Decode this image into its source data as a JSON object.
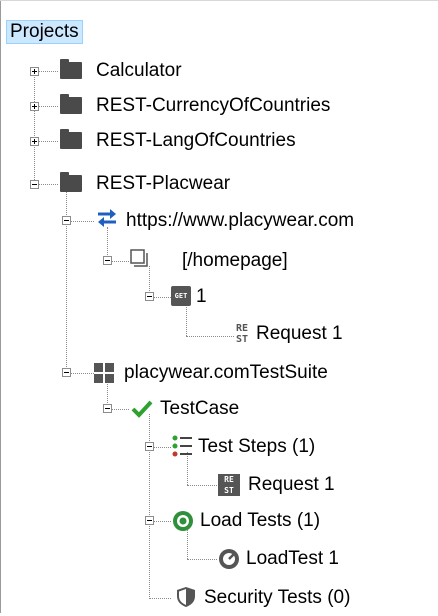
{
  "tree": {
    "root_label": "Projects",
    "projects": [
      {
        "label": "Calculator"
      },
      {
        "label": "REST-CurrencyOfCountries"
      },
      {
        "label": "REST-LangOfCountries"
      },
      {
        "label": "REST-Placwear"
      }
    ],
    "service": {
      "label": "https://www.placywear.com"
    },
    "resource": {
      "label": "[/homepage]"
    },
    "method": {
      "label": "1",
      "badge": "GET"
    },
    "request": {
      "label": "Request 1",
      "badge_top": "RE",
      "badge_bottom": "ST"
    },
    "suite": {
      "label": "placywear.comTestSuite"
    },
    "testcase": {
      "label": "TestCase"
    },
    "test_steps": {
      "label": "Test Steps (1)"
    },
    "step_request": {
      "label": "Request 1",
      "badge_top": "RE",
      "badge_bottom": "ST"
    },
    "load_tests": {
      "label": "Load Tests (1)"
    },
    "load_test": {
      "label": "LoadTest 1"
    },
    "security_tests": {
      "label": "Security Tests (0)"
    }
  },
  "colors": {
    "selection_bg": "#cce8ff",
    "folder": "#4a4a4a",
    "service_icon": "#1f5fbf",
    "testcase_check": "#2ea12e",
    "load_icon": "#2f8f3a"
  },
  "icons": {
    "expand": "plus-box-icon",
    "collapse": "minus-box-icon",
    "folder": "folder-icon",
    "service": "arrows-exchange-icon",
    "resource": "resource-page-icon",
    "method": "get-method-icon",
    "request": "rest-request-icon",
    "suite": "test-suite-grid-icon",
    "testcase": "checkmark-icon",
    "steps": "list-steps-icon",
    "load": "gauge-icon",
    "security": "shield-icon"
  }
}
